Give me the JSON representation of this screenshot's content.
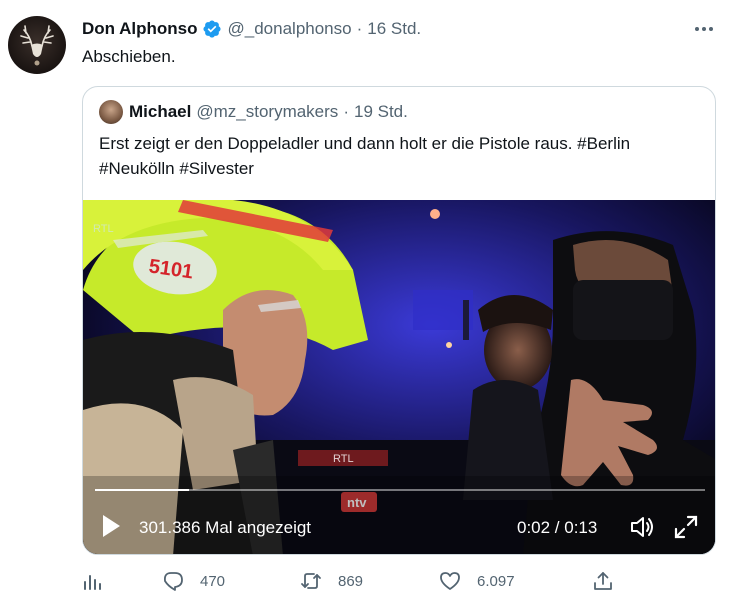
{
  "tweet": {
    "author_name": "Don Alphonso",
    "handle": "@_donalphonso",
    "separator": "·",
    "time": "16 Std.",
    "text": "Abschieben."
  },
  "quote": {
    "author_name": "Michael",
    "handle": "@mz_storymakers",
    "separator": "·",
    "time": "19 Std.",
    "text": "Erst zeigt er den Doppeladler und dann holt er die Pistole raus. #Berlin #Neukölln #Silvester"
  },
  "video": {
    "views": "301.386 Mal angezeigt",
    "timecode": "0:02 / 0:13",
    "progress": 0.154,
    "helmet_number": "5101",
    "channel_logo": "RTL",
    "overlay_logo": "ntv"
  },
  "actions": {
    "replies": "470",
    "retweets": "869",
    "likes": "6.097"
  },
  "colors": {
    "verified": "#1d9bf0",
    "text_primary": "#0f1419",
    "text_secondary": "#536471",
    "border": "#cfd9de"
  },
  "icons": [
    "verified-badge-icon",
    "more-icon",
    "play-icon",
    "volume-icon",
    "fullscreen-icon",
    "analytics-icon",
    "reply-icon",
    "retweet-icon",
    "like-icon",
    "share-icon"
  ]
}
